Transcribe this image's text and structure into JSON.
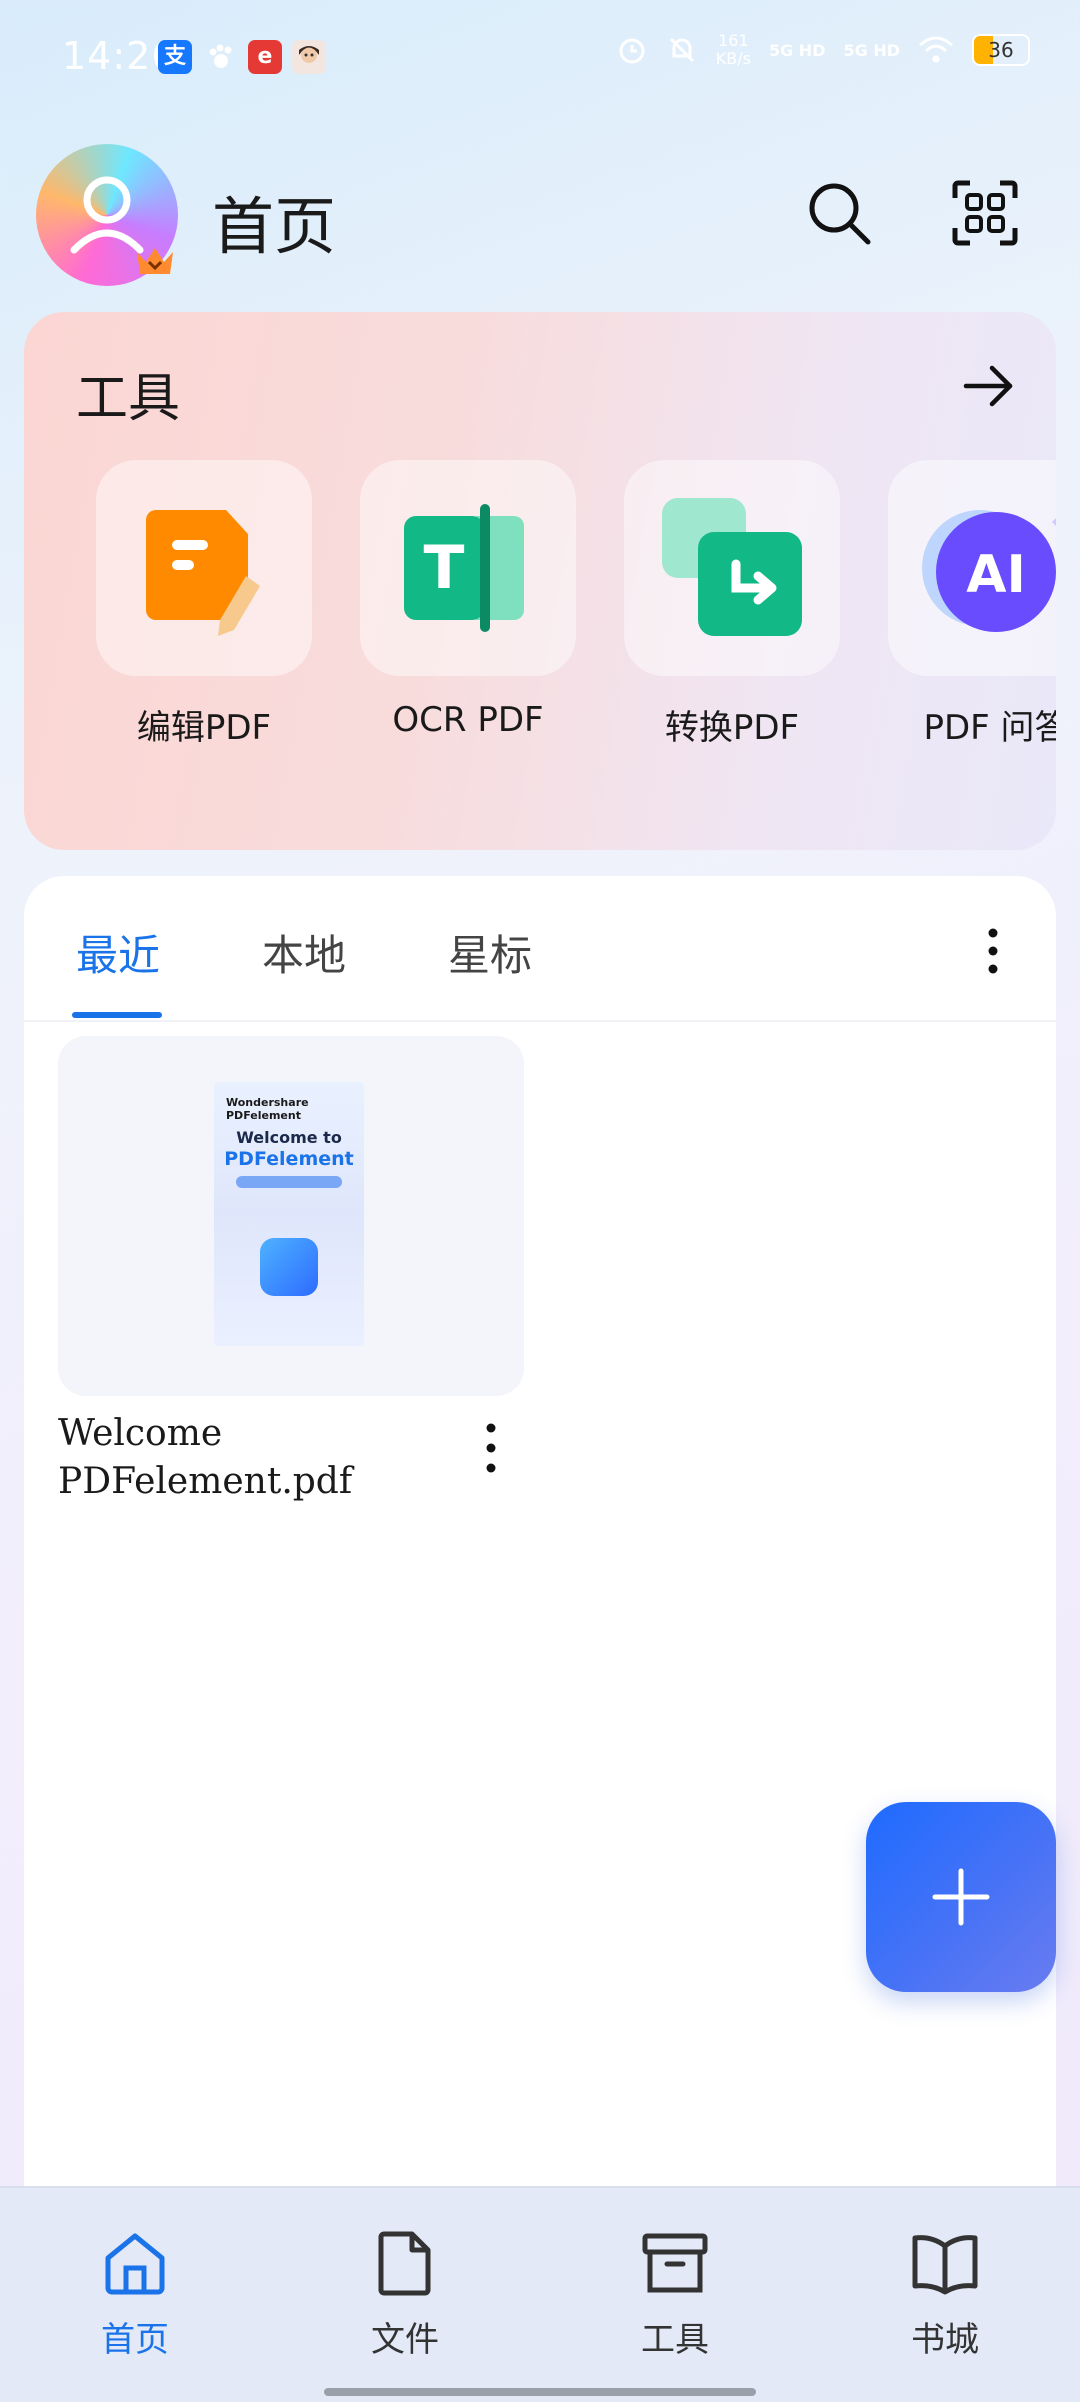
{
  "status_bar": {
    "time": "14:26",
    "net_speed_value": "161",
    "net_speed_unit": "KB/s",
    "signal_1": "5G HD",
    "signal_2": "5G HD",
    "battery": "36",
    "battery_level": 0.36,
    "icons": [
      "alipay-icon",
      "paw-icon",
      "red-app-icon",
      "face-app-icon",
      "alarm-icon",
      "mute-icon",
      "wifi-icon"
    ]
  },
  "header": {
    "title": "首页",
    "icons": [
      "avatar",
      "crown-icon",
      "search-icon",
      "scan-icon"
    ]
  },
  "tools": {
    "title": "工具",
    "items": [
      {
        "label": "编辑PDF",
        "icon": "edit-pdf-icon"
      },
      {
        "label": "OCR PDF",
        "icon": "ocr-pdf-icon"
      },
      {
        "label": "转换PDF",
        "icon": "convert-pdf-icon"
      },
      {
        "label": "PDF 问答",
        "icon": "ai-icon"
      }
    ]
  },
  "tabs": [
    {
      "label": "最近",
      "active": true
    },
    {
      "label": "本地",
      "active": false
    },
    {
      "label": "星标",
      "active": false
    }
  ],
  "files": [
    {
      "name": "Welcome PDFelement.pdf",
      "cover": {
        "brand": "Wondershare PDFelement",
        "welcome": "Welcome to",
        "product": "PDFelement"
      }
    }
  ],
  "bottom_nav": [
    {
      "label": "首页",
      "icon": "home-icon",
      "active": true
    },
    {
      "label": "文件",
      "icon": "file-icon",
      "active": false
    },
    {
      "label": "工具",
      "icon": "archive-icon",
      "active": false
    },
    {
      "label": "书城",
      "icon": "book-icon",
      "active": false
    }
  ],
  "colors": {
    "accent": "#1a73e8",
    "fab": "#1e6bff",
    "edit_icon": "#ff8a00",
    "ocr_icon": "#12b886",
    "ai_icon": "#6a4cff"
  }
}
